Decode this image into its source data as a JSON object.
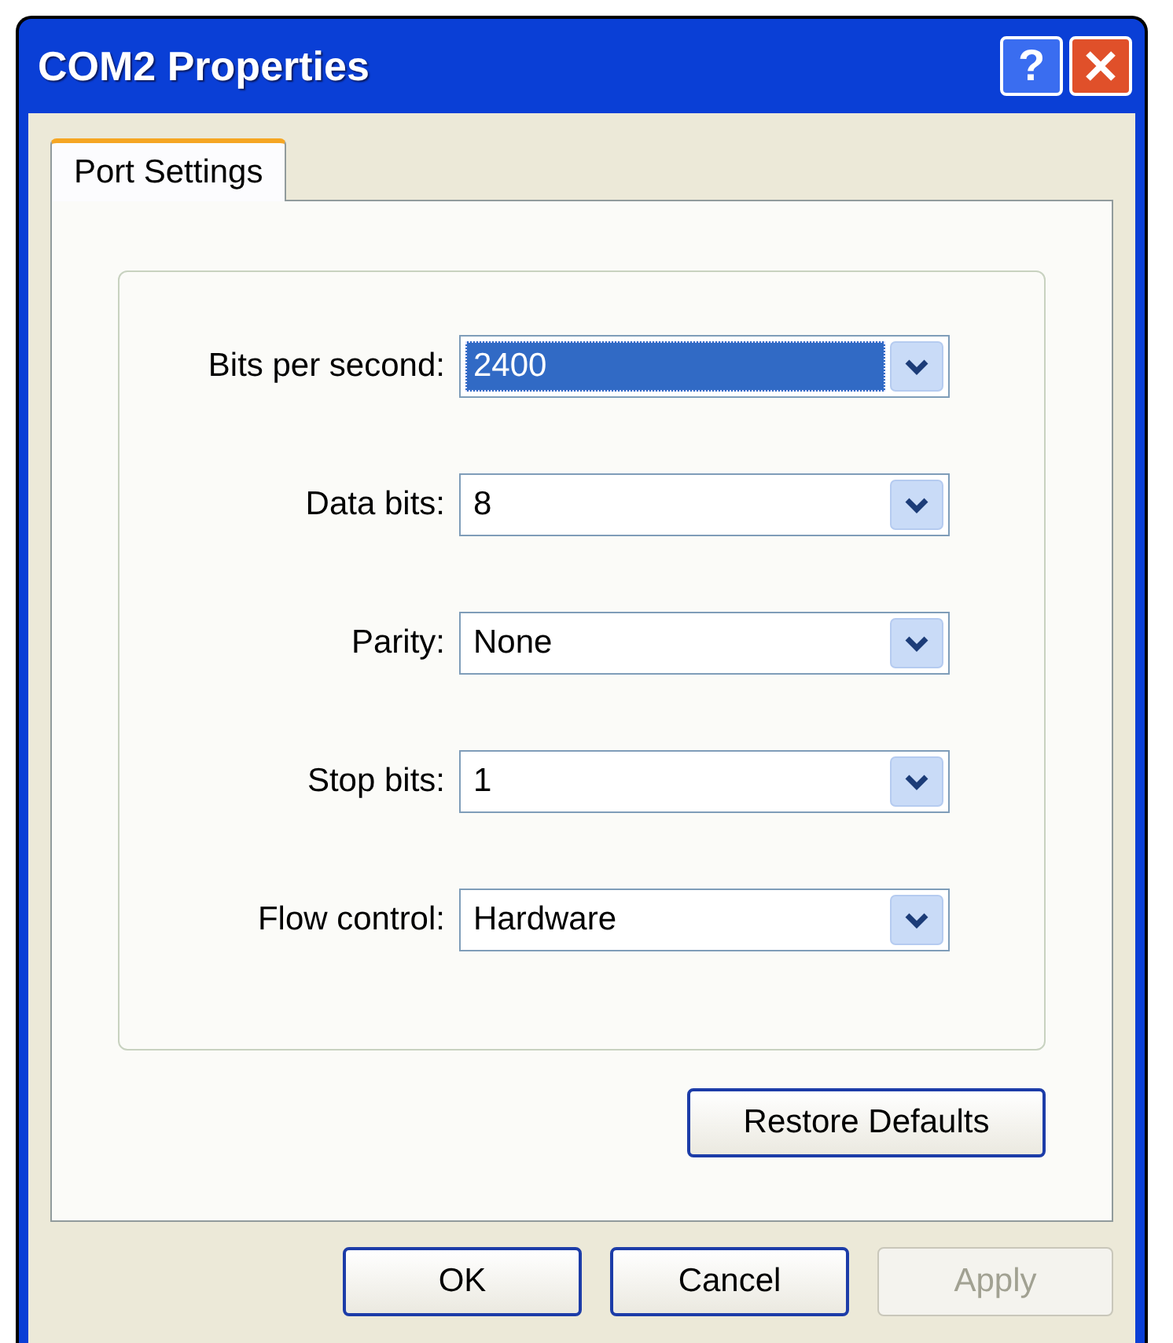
{
  "window": {
    "title": "COM2 Properties"
  },
  "title_buttons": [
    {
      "kind": "help",
      "label": "?"
    },
    {
      "kind": "close"
    }
  ],
  "tabs": [
    {
      "label": "Port Settings",
      "selected": true
    }
  ],
  "fields": [
    {
      "label": "Bits per second:",
      "value": "2400",
      "focused": true
    },
    {
      "label": "Data bits:",
      "value": "8",
      "focused": false
    },
    {
      "label": "Parity:",
      "value": "None",
      "focused": false
    },
    {
      "label": "Stop bits:",
      "value": "1",
      "focused": false
    },
    {
      "label": "Flow control:",
      "value": "Hardware",
      "focused": false
    }
  ],
  "restore_button": {
    "label": "Restore Defaults"
  },
  "buttons": [
    {
      "label": "OK",
      "disabled": false
    },
    {
      "label": "Cancel",
      "disabled": false
    },
    {
      "label": "Apply",
      "disabled": true
    }
  ]
}
